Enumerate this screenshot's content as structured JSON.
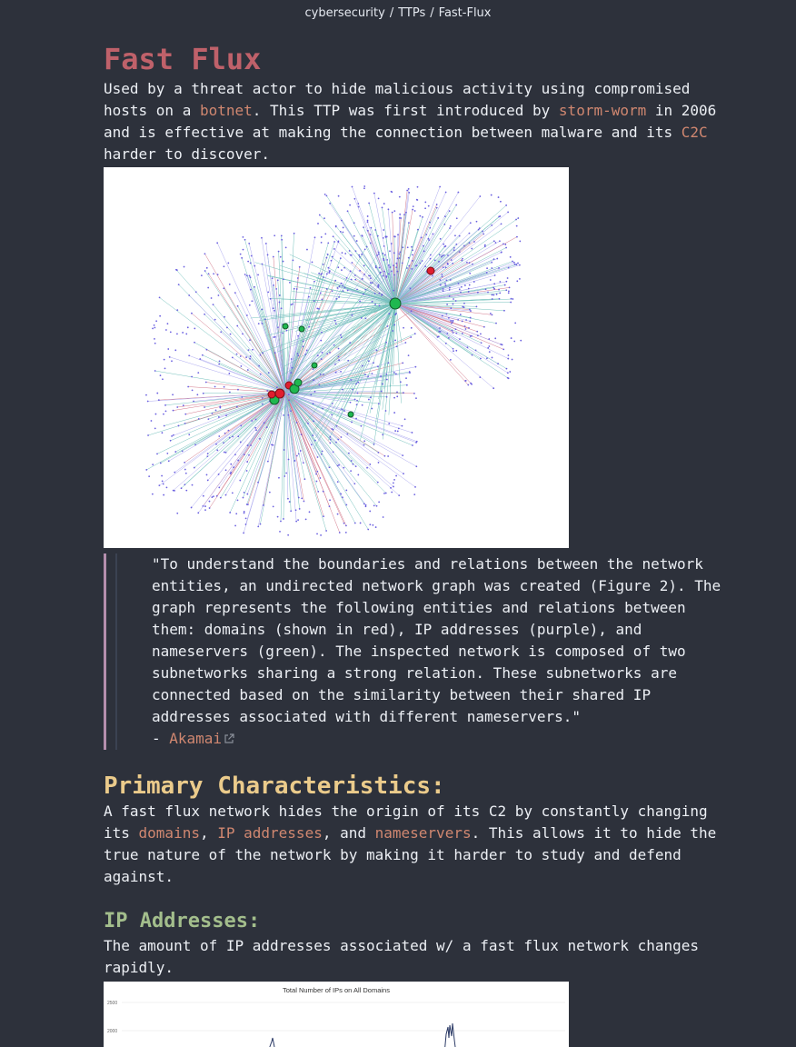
{
  "breadcrumb": [
    "cybersecurity",
    "TTPs",
    "Fast-Flux"
  ],
  "title": "Fast Flux",
  "intro": {
    "t1": "Used by a threat actor to hide malicious activity using compromised hosts on a ",
    "link1": "botnet",
    "t2": ". This TTP was first introduced by ",
    "link2": "storm-worm",
    "t3": " in 2006 and is effective at making the connection between malware and its ",
    "link3": "C2C",
    "t4": " harder to discover."
  },
  "quote": {
    "text": "\"To understand the boundaries and relations between the network entities, an undirected network graph was created (Figure 2). The graph represents the following entities and relations between them: domains (shown in red), IP addresses (purple), and nameservers (green). The inspected network is composed of two subnetworks sharing a strong relation. These subnetworks are connected based on the similarity between their shared IP addresses associated with different nameservers.\"",
    "attribution_prefix": "- ",
    "attribution_link": "Akamai"
  },
  "primary": {
    "heading": "Primary Characteristics:",
    "t1": "A fast flux network hides the origin of its C2 by constantly changing its ",
    "link1": "domains",
    "t2": ", ",
    "link2": "IP addresses",
    "t3": ", and ",
    "link3": "nameservers",
    "t4": ". This allows it to hide the true nature of the network by making it harder to study and defend against."
  },
  "ip": {
    "heading": "IP Addresses:",
    "text": "The amount of IP addresses associated w/ a fast flux network changes rapidly."
  },
  "chart_data": {
    "type": "line",
    "title": "Total Number of IPs on All Domains",
    "yticks": [
      "2500",
      "2000"
    ]
  },
  "colors": {
    "title": "#bf616a",
    "link": "#d08770",
    "primary_heading": "#ebcb8b",
    "sub_heading": "#a3be8c",
    "quote_bar": "#b48ead"
  }
}
